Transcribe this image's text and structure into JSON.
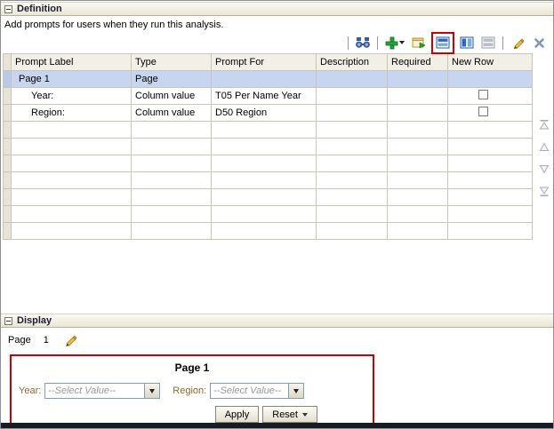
{
  "definition": {
    "title": "Definition",
    "description": "Add prompts for users when they run this analysis.",
    "toolbar_icons": [
      "preview-binoculars",
      "new-plus-dropdown",
      "insert",
      "row-based-layout",
      "column-based-layout",
      "grid-layout",
      "edit-pencil",
      "delete-x"
    ],
    "table": {
      "columns": [
        "Prompt Label",
        "Type",
        "Prompt For",
        "Description",
        "Required",
        "New Row"
      ],
      "rows": [
        {
          "prompt_label": "Page 1",
          "type": "Page",
          "prompt_for": ""
        },
        {
          "prompt_label": "Year:",
          "type": "Column value",
          "prompt_for": "T05 Per Name Year"
        },
        {
          "prompt_label": "Region:",
          "type": "Column value",
          "prompt_for": "D50 Region"
        }
      ]
    },
    "reorder_icons": [
      "move-to-top",
      "move-up",
      "move-down",
      "move-to-bottom"
    ]
  },
  "display": {
    "title": "Display",
    "page_label": "Page",
    "page_number": "1",
    "preview": {
      "title": "Page 1",
      "year_label": "Year:",
      "year_value": "--Select Value--",
      "region_label": "Region:",
      "region_value": "--Select Value--",
      "apply_button": "Apply",
      "reset_button": "Reset"
    }
  }
}
